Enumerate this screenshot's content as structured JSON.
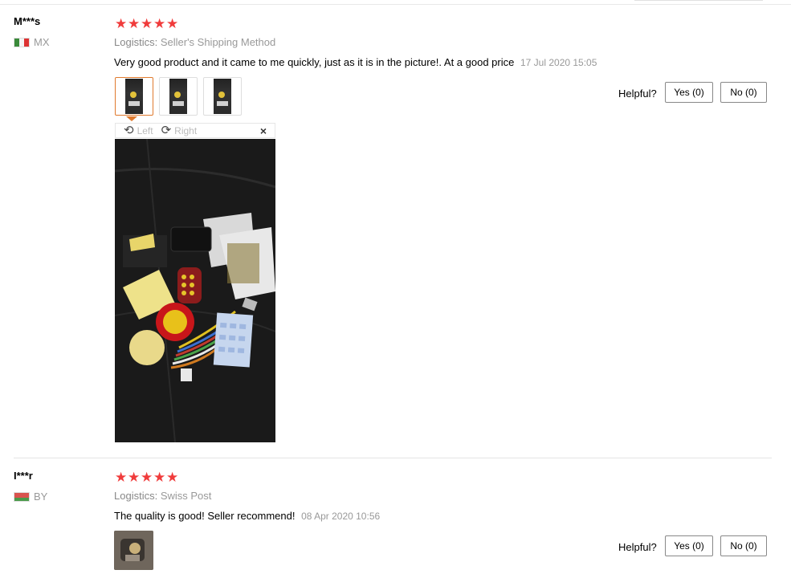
{
  "reviews": [
    {
      "user": "M***s",
      "country": "MX",
      "stars": 5,
      "logistics_label": "Logistics:",
      "logistics_value": "Seller's Shipping Method",
      "text": "Very good product and it came to me quickly, just as it is in the picture!. At a good price",
      "date": "17 Jul 2020 15:05",
      "helpful_label": "Helpful?",
      "yes_label": "Yes (0)",
      "no_label": "No (0)",
      "viewer": {
        "left_label": "Left",
        "right_label": "Right",
        "close_label": "×"
      }
    },
    {
      "user": "I***r",
      "country": "BY",
      "stars": 5,
      "logistics_label": "Logistics:",
      "logistics_value": "Swiss Post",
      "text": "The quality is good! Seller recommend!",
      "date": "08 Apr 2020 10:56",
      "helpful_label": "Helpful?",
      "yes_label": "Yes (0)",
      "no_label": "No (0)"
    }
  ],
  "colors": {
    "star": "#f03c3c",
    "active_thumb_border": "#e07a2e",
    "muted_text": "#999999"
  },
  "icons": {
    "star": "star-icon",
    "rotate_left": "rotate-left-icon",
    "rotate_right": "rotate-right-icon",
    "close": "close-icon"
  }
}
